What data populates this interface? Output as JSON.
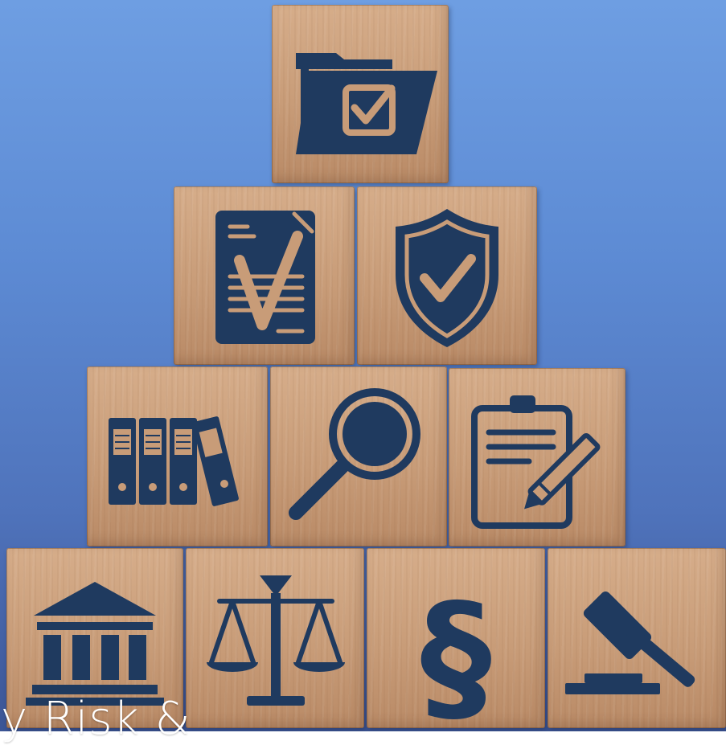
{
  "caption": "ty Risk &",
  "colors": {
    "background_top": "#6e9ee2",
    "background_bottom": "#3c5595",
    "wood": "#c89c78",
    "icon": "#1f3a5f",
    "caption": "#ffffff"
  },
  "blocks": [
    {
      "row": 1,
      "icon": "folder-check-icon"
    },
    {
      "row": 2,
      "icon": "document-check-icon"
    },
    {
      "row": 2,
      "icon": "shield-check-icon"
    },
    {
      "row": 3,
      "icon": "binders-icon"
    },
    {
      "row": 3,
      "icon": "magnifier-icon"
    },
    {
      "row": 3,
      "icon": "clipboard-pencil-icon"
    },
    {
      "row": 4,
      "icon": "courthouse-icon"
    },
    {
      "row": 4,
      "icon": "scales-icon"
    },
    {
      "row": 4,
      "icon": "section-sign-icon"
    },
    {
      "row": 4,
      "icon": "gavel-icon"
    }
  ]
}
